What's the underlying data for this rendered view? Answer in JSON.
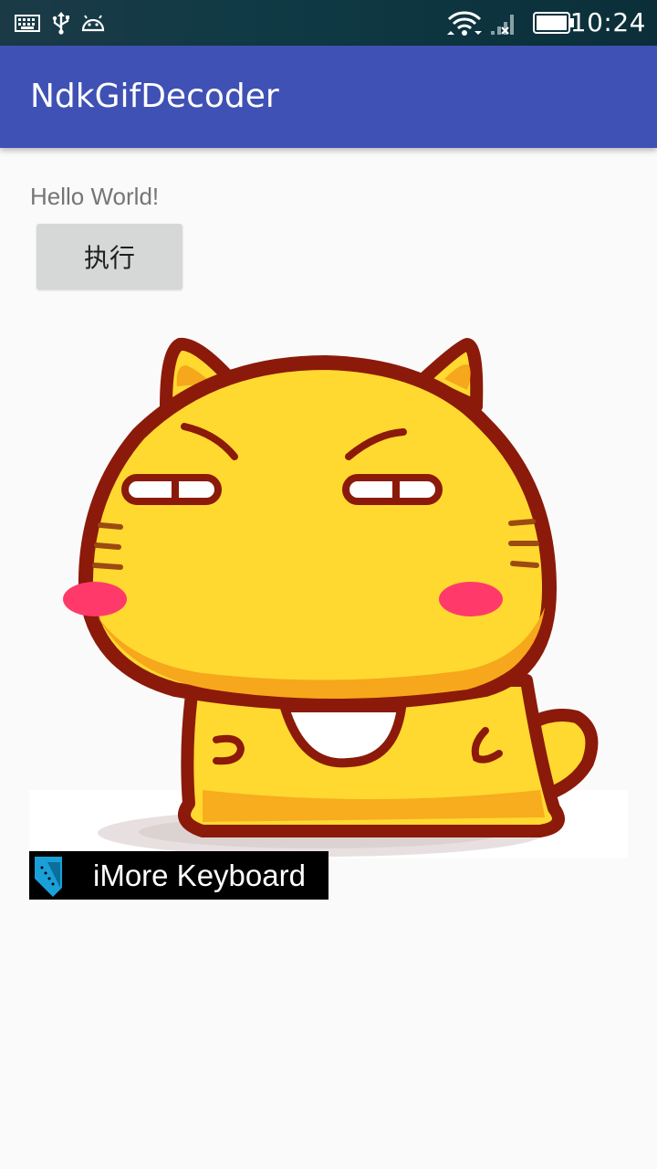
{
  "status_bar": {
    "time": "10:24",
    "left_icons": [
      "keyboard-icon",
      "usb-icon",
      "android-debug-icon"
    ],
    "right_icons": [
      "wifi-icon",
      "cell-signal-no-service-icon",
      "battery-icon"
    ]
  },
  "app_bar": {
    "title": "NdkGifDecoder",
    "color": "#3f51b5"
  },
  "content": {
    "hello_text": "Hello World!",
    "run_button_label": "执行",
    "gif_subject": "cartoon-cat-gif",
    "watermark_text": "iMore Keyboard"
  },
  "colors": {
    "status_bar": "#0f3a45",
    "background": "#fafafa",
    "button": "#d6d7d7",
    "cat_body": "#ffd930",
    "cat_outline": "#8b1a0a",
    "blush": "#ff3a6a"
  }
}
